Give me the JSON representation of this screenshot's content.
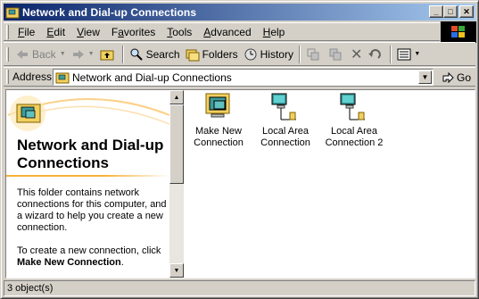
{
  "window": {
    "title": "Network and Dial-up Connections",
    "controls": {
      "minimize": "_",
      "maximize": "□",
      "close": "✕"
    }
  },
  "menu": [
    {
      "label": "File",
      "accel": "F",
      "rest": "ile"
    },
    {
      "label": "Edit",
      "accel": "E",
      "rest": "dit"
    },
    {
      "label": "View",
      "accel": "V",
      "rest": "iew"
    },
    {
      "label": "Favorites",
      "accel": "F",
      "rest": "avorites",
      "accel_index": 1
    },
    {
      "label": "Tools",
      "accel": "T",
      "rest": "ools"
    },
    {
      "label": "Advanced",
      "accel": "A",
      "rest": "dvanced"
    },
    {
      "label": "Help",
      "accel": "H",
      "rest": "elp"
    }
  ],
  "toolbar": {
    "back": "Back",
    "search": "Search",
    "folders": "Folders",
    "history": "History",
    "delete_icon": "✕"
  },
  "address": {
    "label": "Address",
    "value": "Network and Dial-up Connections",
    "go": "Go"
  },
  "left_pane": {
    "title": "Network and Dial-up Connections",
    "description": "This folder contains network connections for this computer, and a wizard to help you create a new connection.",
    "new_prefix": "To create a new connection, click ",
    "new_link": "Make New Connection",
    "new_suffix": "."
  },
  "items": [
    {
      "label": "Make New Connection",
      "icon": "wizard-icon"
    },
    {
      "label": "Local Area Connection",
      "icon": "lan-icon"
    },
    {
      "label": "Local Area Connection 2",
      "icon": "lan-icon"
    }
  ],
  "status": {
    "text": "3 object(s)"
  },
  "colors": {
    "title_start": "#0a246a",
    "title_end": "#a6caf0",
    "accent": "#f7b239",
    "face": "#d4d0c8"
  }
}
